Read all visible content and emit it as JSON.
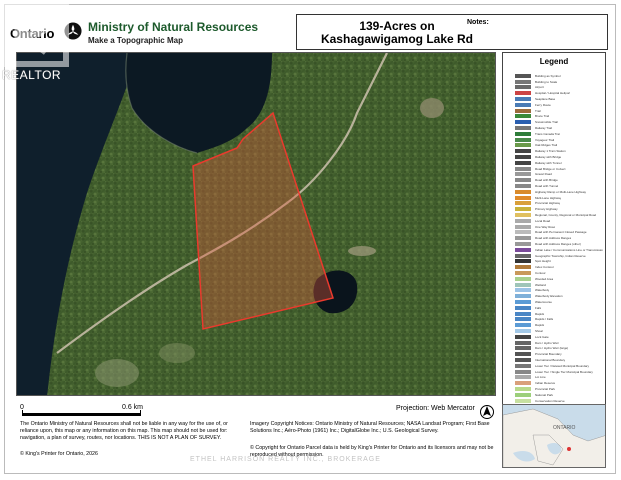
{
  "header": {
    "ontario_wordmark": "Ontario",
    "ministry_title": "Ministry of Natural Resources",
    "ministry_subtitle": "Make a Topographic Map",
    "map_title_line1": "139-Acres on",
    "map_title_line2": "Kashagawigamog Lake Rd",
    "notes_label": "Notes:"
  },
  "watermark": {
    "realtor_text": "REALTOR",
    "bottom_watermark": "ETHEL HARRISON REALTY INC., BROKERAGE"
  },
  "legend": {
    "title": "Legend",
    "items": [
      {
        "label": "Building as Symbol",
        "color": "#555555"
      },
      {
        "label": "Building to Scale",
        "color": "#777777"
      },
      {
        "label": "Airport",
        "color": "#6a6a6a"
      },
      {
        "label": "Hospital / Hospital Heliport",
        "color": "#c44"
      },
      {
        "label": "Seaplane Base",
        "color": "#4a7bb5"
      },
      {
        "label": "Ferry Route",
        "color": "#4a7bb5"
      },
      {
        "label": "Trail",
        "color": "#9c6b3c"
      },
      {
        "label": "Bruce Trail",
        "color": "#3a8a3a"
      },
      {
        "label": "Snowmobile Trail",
        "color": "#2a5fb0"
      },
      {
        "label": "Railway Trail",
        "color": "#777777"
      },
      {
        "label": "Trans Canada Trail",
        "color": "#2f7d3a"
      },
      {
        "label": "Voyageur Trail",
        "color": "#4a8a4a"
      },
      {
        "label": "Oak Ridges Trail",
        "color": "#6a9a4a"
      },
      {
        "label": "Railway 1 Train Station",
        "color": "#444444"
      },
      {
        "label": "Railway with Bridge",
        "color": "#444444"
      },
      {
        "label": "Railway with Tunnel",
        "color": "#444444"
      },
      {
        "label": "Road Bridge or Culvert",
        "color": "#888888"
      },
      {
        "label": "Gravel Road",
        "color": "#999999"
      },
      {
        "label": "Road with Bridge",
        "color": "#888888"
      },
      {
        "label": "Road with Tunnel",
        "color": "#888888"
      },
      {
        "label": "Highway Ramp or Multi-Lane Highway",
        "color": "#d98a2b"
      },
      {
        "label": "Multi-Lane Highway",
        "color": "#e08a2a"
      },
      {
        "label": "Provincial Highway",
        "color": "#d9a03a"
      },
      {
        "label": "Primary Highway",
        "color": "#c9b23a"
      },
      {
        "label": "Regional, County, Regional or Municipal Road",
        "color": "#e0c060"
      },
      {
        "label": "Local Road",
        "color": "#aaaaaa"
      },
      {
        "label": "One Way Road",
        "color": "#aaaaaa"
      },
      {
        "label": "Road with Permanent Closed Passage",
        "color": "#bbbbbb"
      },
      {
        "label": "Road with Address Ranges",
        "color": "#999999"
      },
      {
        "label": "Road with Address Ranges (other)",
        "color": "#999999"
      },
      {
        "label": "Indian Lake / Communications Line or Transmission Line",
        "color": "#7a4a9a"
      },
      {
        "label": "Geographic Township, Indian Reserve",
        "color": "#666666"
      },
      {
        "label": "Spot Height",
        "color": "#333333"
      },
      {
        "label": "Index Contour",
        "color": "#b07a3a"
      },
      {
        "label": "Contour",
        "color": "#c9995a"
      },
      {
        "label": "Wooded Area",
        "color": "#a8d08d"
      },
      {
        "label": "Wetland",
        "color": "#9fc5b8"
      },
      {
        "label": "Waterbody",
        "color": "#9cc3e6"
      },
      {
        "label": "Waterbody Elevation",
        "color": "#7fb0d9"
      },
      {
        "label": "Watercourse",
        "color": "#5b9bd5"
      },
      {
        "label": "Falls",
        "color": "#4a86c5"
      },
      {
        "label": "Rapids",
        "color": "#4a86c5"
      },
      {
        "label": "Rapids / Falls",
        "color": "#4a86c5"
      },
      {
        "label": "Rapids",
        "color": "#5b9bd5"
      },
      {
        "label": "Shoal",
        "color": "#a3c9e8"
      },
      {
        "label": "Lock Gate",
        "color": "#444444"
      },
      {
        "label": "Dam / Hydro Weir",
        "color": "#666666"
      },
      {
        "label": "Dam / Hydro Weir (large)",
        "color": "#666666"
      },
      {
        "label": "Provincial Boundary",
        "color": "#555555"
      },
      {
        "label": "International Boundary",
        "color": "#555555"
      },
      {
        "label": "Lower Tier / Deleted Municipal Boundary",
        "color": "#777777"
      },
      {
        "label": "Lower Tier / Single Tier Municipal Boundary",
        "color": "#888888"
      },
      {
        "label": "Lot Line",
        "color": "#aaaaaa"
      },
      {
        "label": "Indian Reserve",
        "color": "#d9a07a"
      },
      {
        "label": "Provincial Park",
        "color": "#b8d98a"
      },
      {
        "label": "National Park",
        "color": "#9ccf7a"
      },
      {
        "label": "Conservation Reserve",
        "color": "#c7e0a0"
      },
      {
        "label": "Military Lands",
        "color": "#e0b0a0"
      }
    ]
  },
  "scale": {
    "zero_label": "0",
    "max_label": "0.6 km"
  },
  "projection_label": "Projection: Web Mercator",
  "disclaimer": "The Ontario Ministry of Natural Resources shall not be liable in any way for the use of, or reliance upon, this map or any information on this map. This map should not be used for: navigation, a plan of survey, routes, nor locations. THIS IS NOT A PLAN OF SURVEY.",
  "kings_printer": "© King's Printer for Ontario, 2026",
  "imagery_notice": "Imagery Copyright Notices: Ontario Ministry of Natural Resources; NASA Landsat Program; First Base Solutions Inc.; Aéro-Photo (1961) Inc.; DigitalGlobe Inc.; U.S. Geological Survey.",
  "parcel_notice": "© Copyright for Ontario Parcel data is held by King's Printer for Ontario and its licensors and may not be reproduced without permission.",
  "inset_map": {
    "label": "ONTARIO",
    "land_color": "#f2efe9",
    "water_color": "#c9dcea",
    "marker_color": "#d33"
  },
  "map": {
    "parcel_outline_color": "#e0342b",
    "parcel_fill": "rgba(230,80,60,0.35)",
    "lake_color": "#0c1a24",
    "forest_color": "#3f5a2a"
  }
}
